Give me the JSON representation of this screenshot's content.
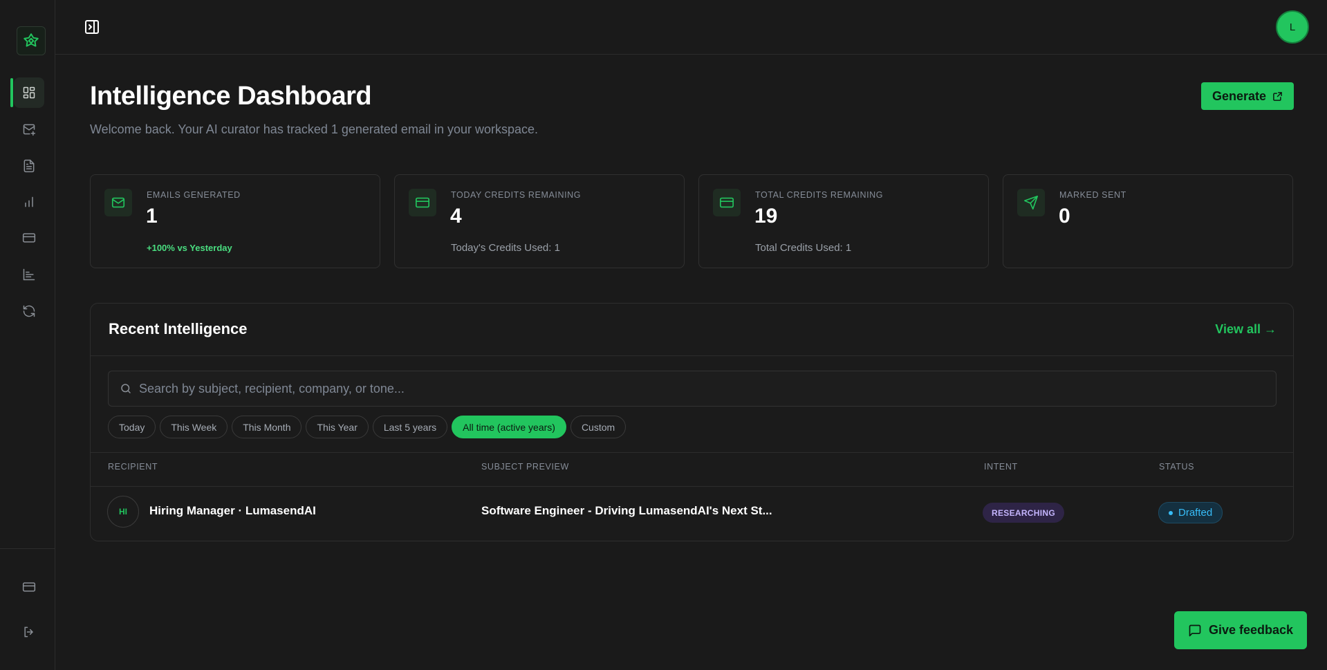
{
  "app": {
    "avatar_initial": "L"
  },
  "header": {
    "title": "Intelligence Dashboard",
    "subtitle": "Welcome back. Your AI curator has tracked 1 generated email in your workspace.",
    "generate_label": "Generate"
  },
  "stats": [
    {
      "label": "EMAILS GENERATED",
      "value": "1",
      "sub": "+100% vs Yesterday",
      "icon": "mail-icon"
    },
    {
      "label": "TODAY CREDITS REMAINING",
      "value": "4",
      "sub": "Today's Credits Used: 1",
      "icon": "credit-card-icon"
    },
    {
      "label": "TOTAL CREDITS REMAINING",
      "value": "19",
      "sub": "Total Credits Used: 1",
      "icon": "credit-card-icon"
    },
    {
      "label": "MARKED SENT",
      "value": "0",
      "sub": "",
      "icon": "send-icon"
    }
  ],
  "recent": {
    "title": "Recent Intelligence",
    "view_all": "View all →",
    "search_placeholder": "Search by subject, recipient, company, or tone...",
    "filters": [
      "Today",
      "This Week",
      "This Month",
      "This Year",
      "Last 5 years",
      "All time (active years)",
      "Custom"
    ],
    "active_filter": "All time (active years)",
    "columns": [
      "RECIPIENT",
      "SUBJECT PREVIEW",
      "INTENT",
      "STATUS"
    ],
    "rows": [
      {
        "initials": "HI",
        "recipient": "Hiring Manager · LumasendAI",
        "subject": "Software Engineer - Driving LumasendAI's Next St...",
        "intent": "RESEARCHING",
        "status": "Drafted"
      }
    ]
  },
  "feedback_label": "Give feedback",
  "colors": {
    "accent": "#22c55e",
    "background": "#1a1a1a",
    "intent": "#c4b5fd",
    "status": "#38bdf8"
  }
}
